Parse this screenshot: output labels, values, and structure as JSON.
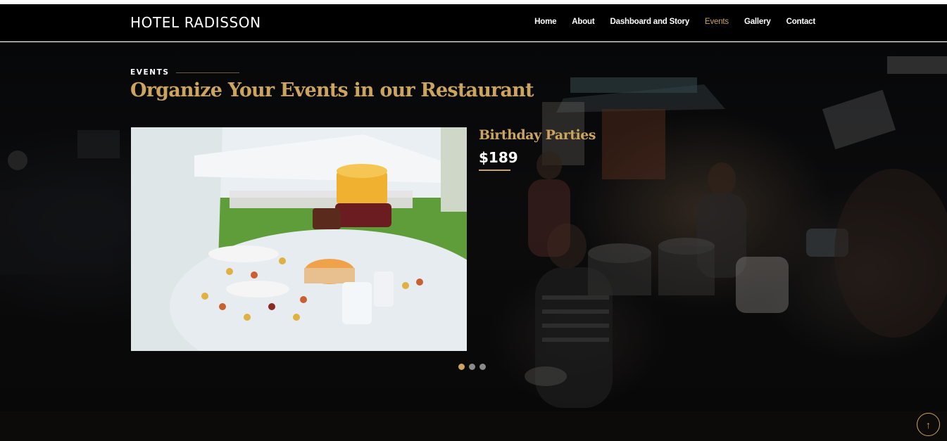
{
  "brand": "HOTEL RADISSON",
  "nav": {
    "items": [
      "Home",
      "About",
      "Dashboard and Story",
      "Events",
      "Gallery",
      "Contact"
    ],
    "active": "Events"
  },
  "section": {
    "tag": "EVENTS",
    "title": "Organize Your Events in our Restaurant"
  },
  "event": {
    "name": "Birthday Parties",
    "price": "$189"
  },
  "carousel": {
    "slides": 3,
    "active_index": 0
  },
  "back_to_top": {
    "icon": "arrow-up-icon",
    "glyph": "↑"
  },
  "colors": {
    "accent": "#cda45e",
    "nav_bg": "#000000",
    "footer_bg": "#0c0b09"
  }
}
